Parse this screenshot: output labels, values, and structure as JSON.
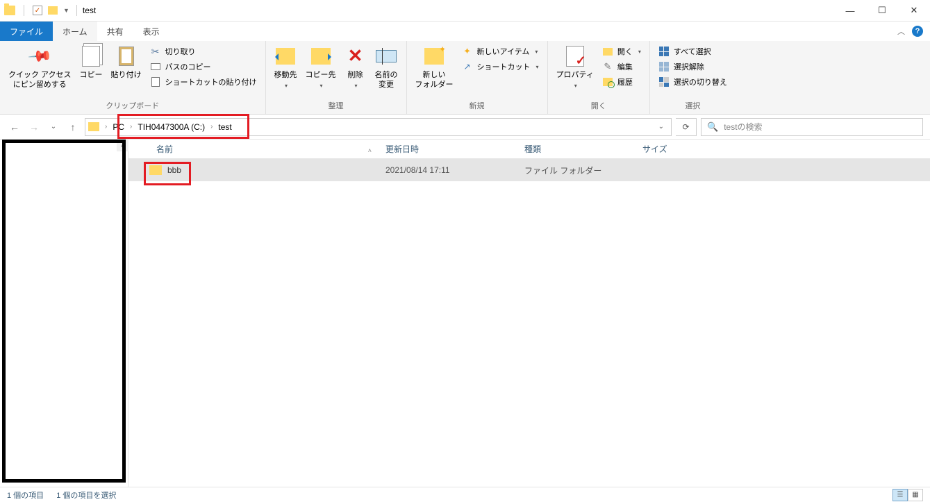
{
  "window": {
    "title": "test"
  },
  "tabs": {
    "file": "ファイル",
    "home": "ホーム",
    "share": "共有",
    "view": "表示"
  },
  "ribbon": {
    "clipboard": {
      "label": "クリップボード",
      "pin": "クイック アクセス\nにピン留めする",
      "copy": "コピー",
      "paste": "貼り付け",
      "cut": "切り取り",
      "copy_path": "パスのコピー",
      "paste_shortcut": "ショートカットの貼り付け"
    },
    "organize": {
      "label": "整理",
      "move_to": "移動先",
      "copy_to": "コピー先",
      "delete": "削除",
      "rename": "名前の\n変更"
    },
    "new": {
      "label": "新規",
      "new_folder": "新しい\nフォルダー",
      "new_item": "新しいアイテム",
      "shortcut": "ショートカット"
    },
    "open": {
      "label": "開く",
      "properties": "プロパティ",
      "open": "開く",
      "edit": "編集",
      "history": "履歴"
    },
    "select": {
      "label": "選択",
      "select_all": "すべて選択",
      "select_none": "選択解除",
      "invert": "選択の切り替え"
    }
  },
  "breadcrumb": {
    "pc": "PC",
    "drive": "TIH0447300A (C:)",
    "folder": "test"
  },
  "search": {
    "placeholder": "testの検索"
  },
  "columns": {
    "name": "名前",
    "date": "更新日時",
    "type": "種類",
    "size": "サイズ"
  },
  "rows": [
    {
      "name": "bbb",
      "date": "2021/08/14 17:11",
      "type": "ファイル フォルダー",
      "size": ""
    }
  ],
  "status": {
    "count": "1 個の項目",
    "selected": "1 個の項目を選択"
  }
}
